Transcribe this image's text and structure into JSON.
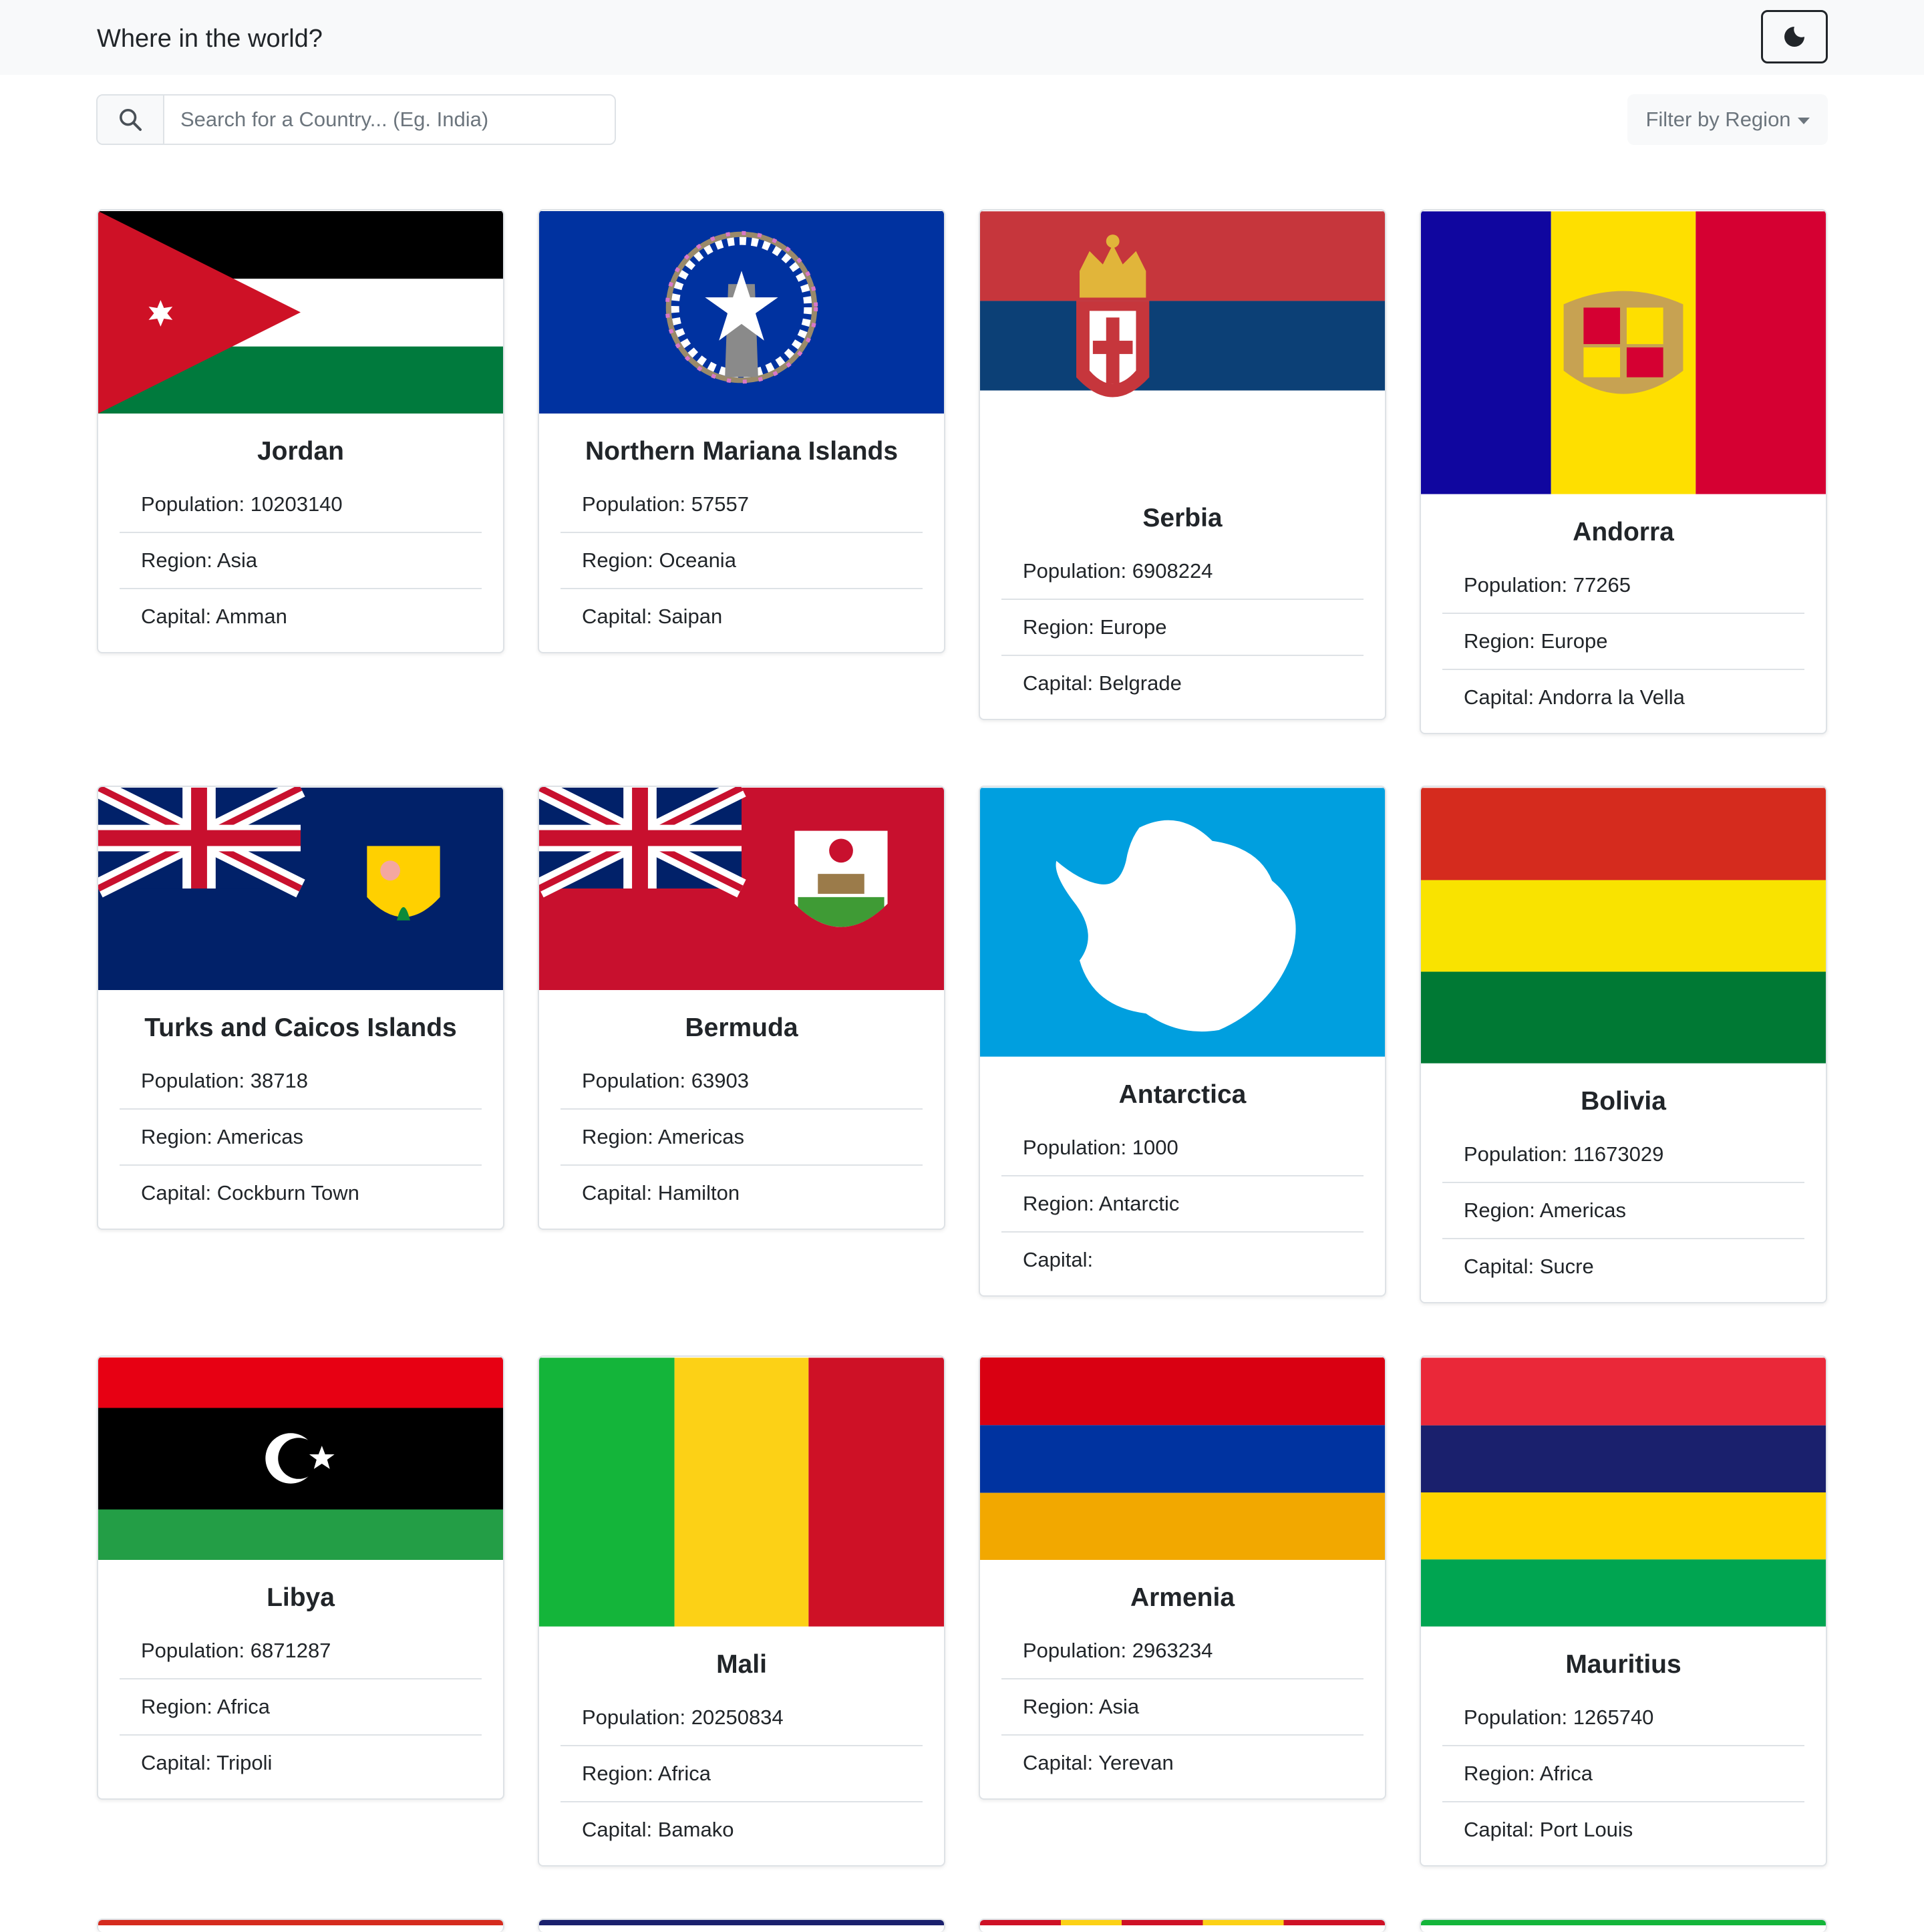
{
  "header": {
    "title": "Where in the world?",
    "theme_icon": "moon-icon"
  },
  "search": {
    "placeholder": "Search for a Country... (Eg. India)",
    "value": ""
  },
  "filter": {
    "label": "Filter by Region"
  },
  "labels": {
    "population": "Population: ",
    "region": "Region: ",
    "capital": "Capital: "
  },
  "countries": [
    {
      "name": "Jordan",
      "population": "10203140",
      "region": "Asia",
      "capital": "Amman"
    },
    {
      "name": "Northern Mariana Islands",
      "population": "57557",
      "region": "Oceania",
      "capital": "Saipan"
    },
    {
      "name": "Serbia",
      "population": "6908224",
      "region": "Europe",
      "capital": "Belgrade"
    },
    {
      "name": "Andorra",
      "population": "77265",
      "region": "Europe",
      "capital": "Andorra la Vella"
    },
    {
      "name": "Turks and Caicos Islands",
      "population": "38718",
      "region": "Americas",
      "capital": "Cockburn Town"
    },
    {
      "name": "Bermuda",
      "population": "63903",
      "region": "Americas",
      "capital": "Hamilton"
    },
    {
      "name": "Antarctica",
      "population": "1000",
      "region": "Antarctic",
      "capital": ""
    },
    {
      "name": "Bolivia",
      "population": "11673029",
      "region": "Americas",
      "capital": "Sucre"
    },
    {
      "name": "Libya",
      "population": "6871287",
      "region": "Africa",
      "capital": "Tripoli"
    },
    {
      "name": "Mali",
      "population": "20250834",
      "region": "Africa",
      "capital": "Bamako"
    },
    {
      "name": "Armenia",
      "population": "2963234",
      "region": "Asia",
      "capital": "Yerevan"
    },
    {
      "name": "Mauritius",
      "population": "1265740",
      "region": "Africa",
      "capital": "Port Louis"
    }
  ],
  "flag_colors": {
    "jordan": [
      "#000000",
      "#ffffff",
      "#007a3d",
      "#ce1126"
    ],
    "nmi": [
      "#0032a0",
      "#ffffff"
    ],
    "serbia": [
      "#c6363c",
      "#0c4076",
      "#ffffff"
    ],
    "andorra": [
      "#10069f",
      "#fedf00",
      "#d50032"
    ],
    "turks_caicos": [
      "#012169",
      "#c8102e",
      "#ffffff",
      "#ffd000"
    ],
    "bermuda": [
      "#c8102e",
      "#012169",
      "#ffffff"
    ],
    "antarctica": [
      "#009fdf",
      "#ffffff"
    ],
    "bolivia": [
      "#d52b1e",
      "#f9e300",
      "#007934"
    ],
    "libya": [
      "#e70013",
      "#000000",
      "#239e46"
    ],
    "mali": [
      "#14b53a",
      "#fcd116",
      "#ce1126"
    ],
    "armenia": [
      "#d90012",
      "#0033a0",
      "#f2a800"
    ],
    "mauritius": [
      "#ea2839",
      "#1a206d",
      "#ffd500",
      "#00a551"
    ]
  }
}
